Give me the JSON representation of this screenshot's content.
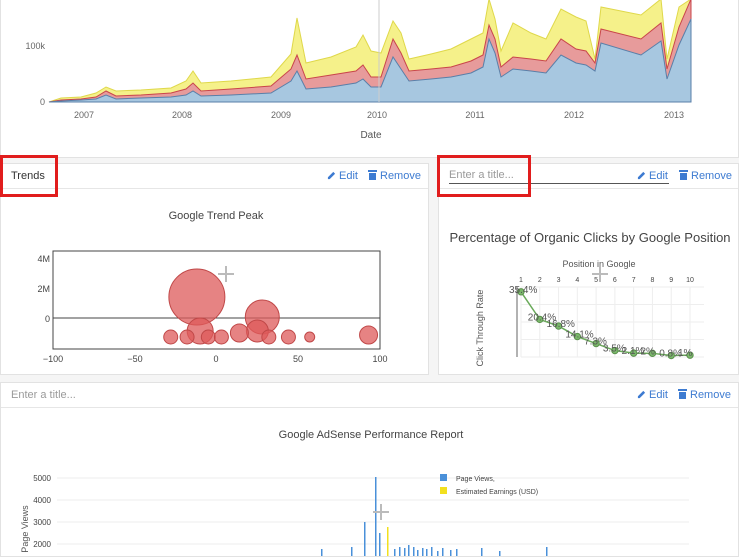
{
  "top_chart": {
    "xlabel": "Date",
    "y_ticks": [
      "0",
      "100k"
    ],
    "x_ticks": [
      "2007",
      "2008",
      "2009",
      "2010",
      "2011",
      "2012",
      "2013"
    ],
    "series_colors": {
      "blue": "#a7c7e0",
      "red": "#e79b9b",
      "yellow": "#f5f18a"
    }
  },
  "trends_panel": {
    "title": "Trends",
    "edit_label": "Edit",
    "remove_label": "Remove",
    "chart_title": "Google Trend Peak",
    "y_ticks": [
      "4M",
      "2M",
      "0"
    ],
    "x_ticks": [
      "−100",
      "−50",
      "0",
      "50",
      "100"
    ]
  },
  "organic_panel": {
    "title_placeholder": "Enter a title...",
    "edit_label": "Edit",
    "remove_label": "Remove",
    "chart_title": "Percentage of Organic Clicks by Google Position",
    "x_axis_title": "Position in Google",
    "y_axis_title": "Click Through Rate",
    "positions": [
      "1",
      "2",
      "3",
      "4",
      "5",
      "6",
      "7",
      "8",
      "9",
      "10"
    ],
    "labels": [
      "35.4%",
      "20.4%",
      "16.8%",
      "14.1%",
      "7.3%",
      "3.5%",
      "2.1%",
      "2%",
      "0.8%",
      "1%"
    ]
  },
  "adsense_panel": {
    "title_placeholder": "Enter a title...",
    "edit_label": "Edit",
    "remove_label": "Remove",
    "chart_title": "Google AdSense Performance Report",
    "y_axis_title": "Page Views",
    "y_ticks": [
      "5000",
      "4000",
      "3000",
      "2000"
    ],
    "legend": [
      "Page Views,",
      "Estimated Earnings (USD)"
    ],
    "legend_colors": [
      "#4a90d9",
      "#f2e01e"
    ]
  },
  "chart_data": [
    {
      "type": "scatter",
      "title": "Google Trend Peak",
      "xlim": [
        -100,
        100
      ],
      "ylim": [
        -0.5,
        4.4
      ],
      "points": [
        {
          "x": -12,
          "y": 2.1,
          "size": 28
        },
        {
          "x": 28,
          "y": 1.1,
          "size": 17
        },
        {
          "x": -10,
          "y": 0.4,
          "size": 13
        },
        {
          "x": 25,
          "y": 0.4,
          "size": 11
        },
        {
          "x": 14,
          "y": 0.3,
          "size": 9
        },
        {
          "x": -28,
          "y": 0.1,
          "size": 7
        },
        {
          "x": -18,
          "y": 0.1,
          "size": 7
        },
        {
          "x": -5,
          "y": 0.1,
          "size": 7
        },
        {
          "x": 3,
          "y": 0.1,
          "size": 7
        },
        {
          "x": 32,
          "y": 0.1,
          "size": 7
        },
        {
          "x": 44,
          "y": 0.1,
          "size": 7
        },
        {
          "x": 57,
          "y": 0.1,
          "size": 5
        },
        {
          "x": 93,
          "y": 0.2,
          "size": 9
        }
      ]
    },
    {
      "type": "line",
      "title": "Percentage of Organic Clicks by Google Position",
      "x": [
        1,
        2,
        3,
        4,
        5,
        6,
        7,
        8,
        9,
        10
      ],
      "y": [
        35.4,
        20.4,
        16.8,
        11.1,
        7.3,
        3.5,
        2.1,
        2,
        0.8,
        1
      ]
    }
  ]
}
